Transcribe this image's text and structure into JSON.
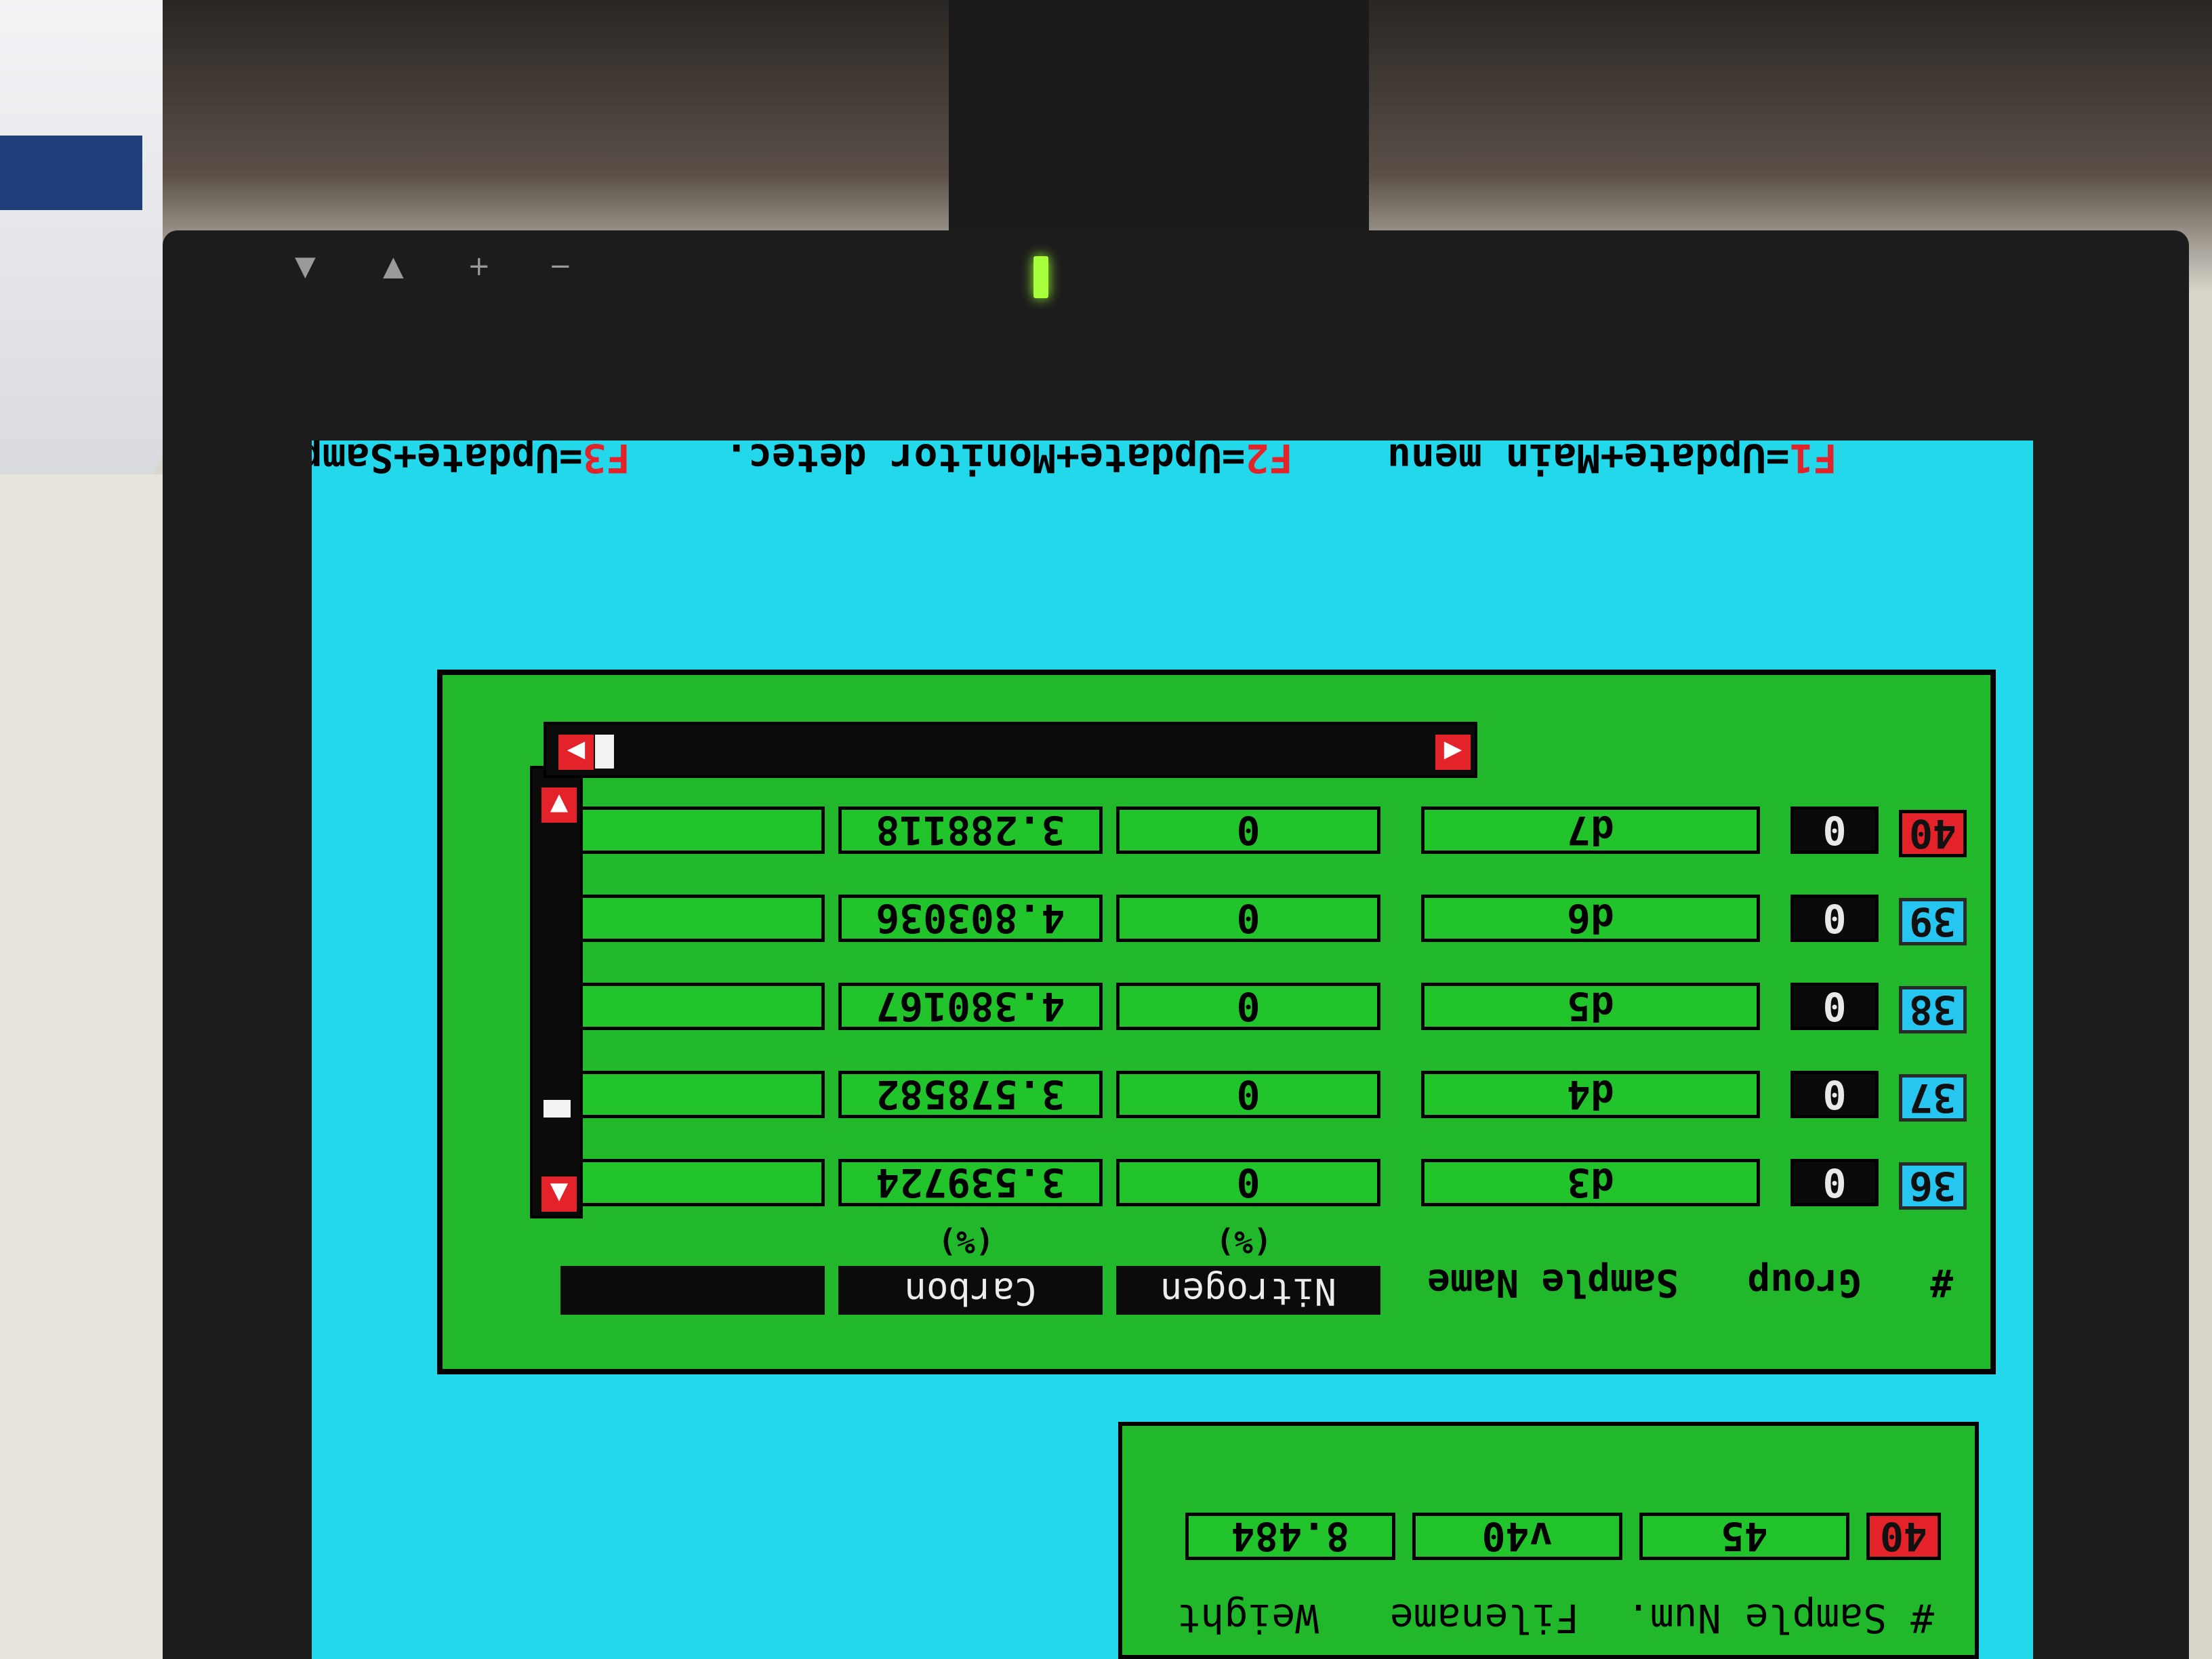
{
  "bezel": {
    "buttons": [
      "▼",
      "▲",
      "+",
      "−"
    ]
  },
  "top_panel": {
    "header": "# Sample Num.  Filename   Weight",
    "row": {
      "index": "40",
      "sample_num": "45",
      "filename": "v40",
      "weight": "8.484"
    }
  },
  "table": {
    "columns": {
      "index": "#",
      "group": "Group",
      "sample_name": "Sample Name",
      "nitrogen": "Nitrogen",
      "nitrogen_unit": "(%)",
      "carbon": "Carbon",
      "carbon_unit": "(%)",
      "extra": ""
    },
    "rows": [
      {
        "index": "36",
        "group": "0",
        "name": "d3",
        "nitrogen": "0",
        "carbon": "3.539724",
        "extra": "",
        "state": "normal"
      },
      {
        "index": "37",
        "group": "0",
        "name": "d4",
        "nitrogen": "0",
        "carbon": "3.578582",
        "extra": "",
        "state": "normal"
      },
      {
        "index": "38",
        "group": "0",
        "name": "d5",
        "nitrogen": "0",
        "carbon": "4.380167",
        "extra": "",
        "state": "normal"
      },
      {
        "index": "39",
        "group": "0",
        "name": "d6",
        "nitrogen": "0",
        "carbon": "4.803036",
        "extra": "",
        "state": "normal"
      },
      {
        "index": "40",
        "group": "0",
        "name": "d7",
        "nitrogen": "0",
        "carbon": "3.288118",
        "extra": "",
        "state": "selected"
      }
    ]
  },
  "status": {
    "f1_key": "F1",
    "f1_text": "=Update+Main menu",
    "f2_key": "F2",
    "f2_text": "=Update+Monitor detec.",
    "f3_key": "F3",
    "f3_text": "=Update+Samples Table"
  },
  "colors": {
    "screen_bg": "#22d8ea",
    "panel": "#21b82b",
    "highlight": "#e3222a",
    "row_index": "#27c6f0"
  }
}
